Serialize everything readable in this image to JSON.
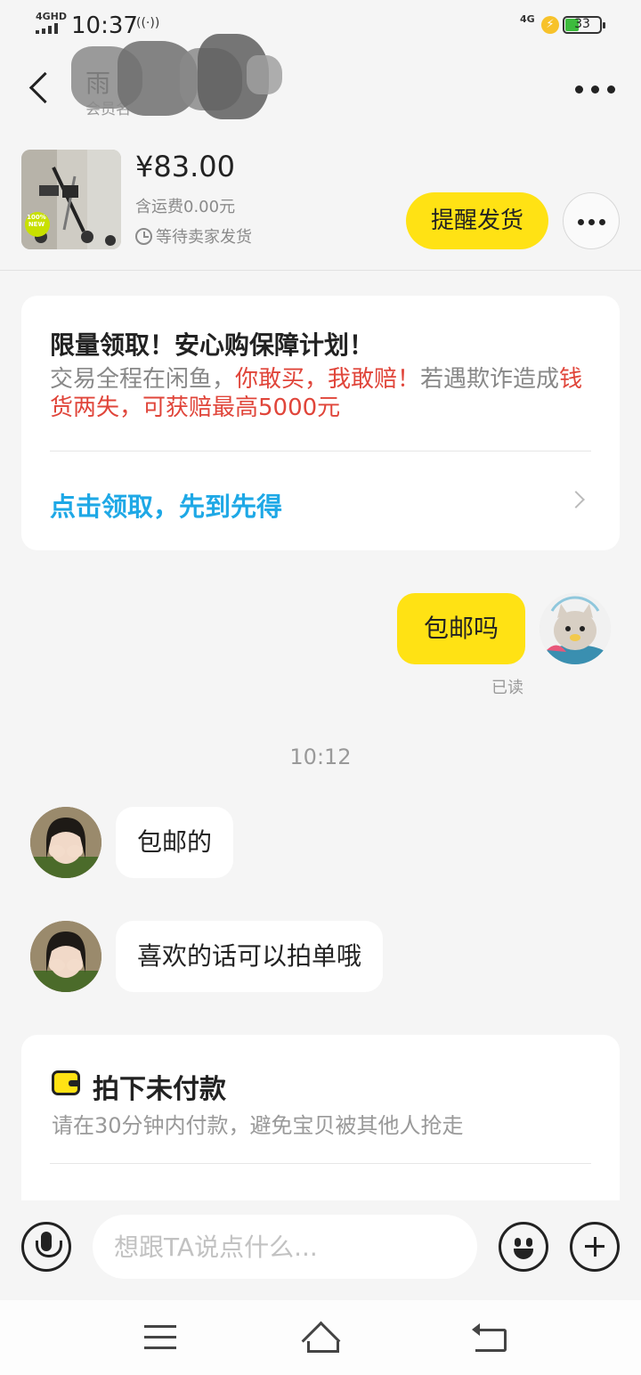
{
  "status_bar": {
    "network_left": "4GHD",
    "time": "10:37",
    "hotspot_icon": "((·))",
    "network_right": "4G",
    "battery": "33"
  },
  "nav": {
    "title": "雨",
    "subtitle": "会员名"
  },
  "product": {
    "thumb_badge": "100% NEW",
    "price": "¥83.00",
    "shipping": "含运费0.00元",
    "status": "等待卖家发货",
    "remind_label": "提醒发货"
  },
  "promo": {
    "title": "限量领取！安心购保障计划！",
    "body_1": "交易全程在闲鱼，",
    "body_red_1": "你敢买，我敢赔",
    "body_red_2": "！",
    "body_2": "若遇欺诈造成",
    "body_red_3": "钱货两失，可获赔最高5000元",
    "link": "点击领取，先到先得"
  },
  "messages": {
    "mine_text": "包邮吗",
    "read_label": "已读",
    "time_separator": "10:12",
    "reply_1": "包邮的",
    "reply_2": "喜欢的话可以拍单哦"
  },
  "order_card": {
    "title": "拍下未付款",
    "subtitle": "请在30分钟内付款，避免宝贝被其他人抢走"
  },
  "input": {
    "placeholder": "想跟TA说点什么..."
  },
  "colors": {
    "accent": "#ffe214",
    "link_blue": "#1ea8e6",
    "promo_red": "#e0453a",
    "background": "#f5f5f5"
  },
  "icons": [
    "back-icon",
    "more-icon",
    "clock-icon",
    "chevron-right-icon",
    "wallet-icon",
    "mic-icon",
    "emoji-icon",
    "plus-icon",
    "menu-icon",
    "home-icon",
    "return-icon"
  ]
}
